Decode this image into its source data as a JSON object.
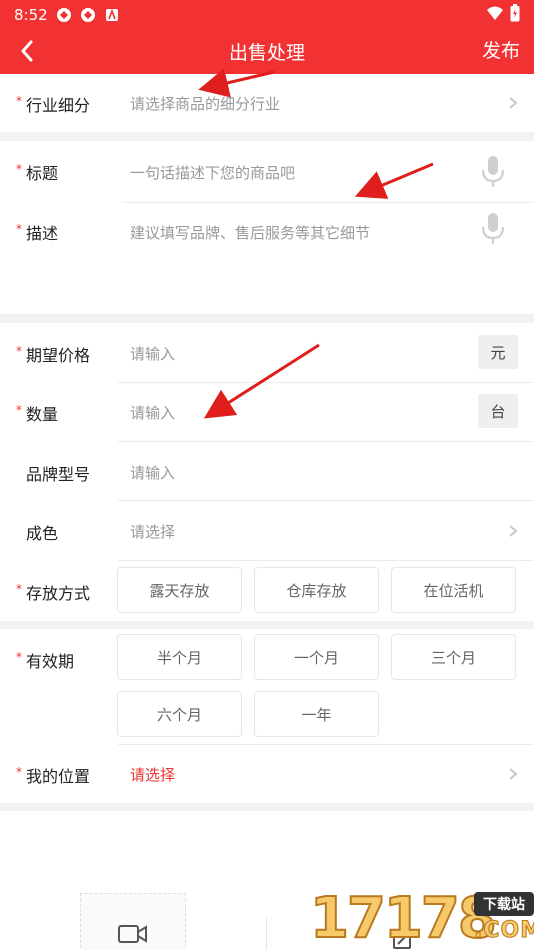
{
  "status_bar": {
    "time": "8:52"
  },
  "header": {
    "title": "出售处理",
    "publish_label": "发布"
  },
  "form": {
    "industry": {
      "label": "行业细分",
      "placeholder": "请选择商品的细分行业"
    },
    "title_field": {
      "label": "标题",
      "placeholder": "一句话描述下您的商品吧"
    },
    "description": {
      "label": "描述",
      "placeholder": "建议填写品牌、售后服务等其它细节"
    },
    "price": {
      "label": "期望价格",
      "placeholder": "请输入",
      "unit": "元"
    },
    "quantity": {
      "label": "数量",
      "placeholder": "请输入",
      "unit": "台"
    },
    "brand_model": {
      "label": "品牌型号",
      "placeholder": "请输入"
    },
    "condition": {
      "label": "成色",
      "placeholder": "请选择"
    },
    "storage": {
      "label": "存放方式",
      "options": [
        "露天存放",
        "仓库存放",
        "在位活机"
      ]
    },
    "validity": {
      "label": "有效期",
      "options": [
        "半个月",
        "一个月",
        "三个月",
        "六个月",
        "一年"
      ]
    },
    "location": {
      "label": "我的位置",
      "value": "请选择"
    }
  },
  "required_mark": "*",
  "watermark": {
    "number": "17178",
    "badge": "下载站",
    "domain": ".COM"
  },
  "colors": {
    "brand_red": "#f23232",
    "placeholder_gray": "#999999",
    "annotation_arrow": "#e01e1e"
  }
}
